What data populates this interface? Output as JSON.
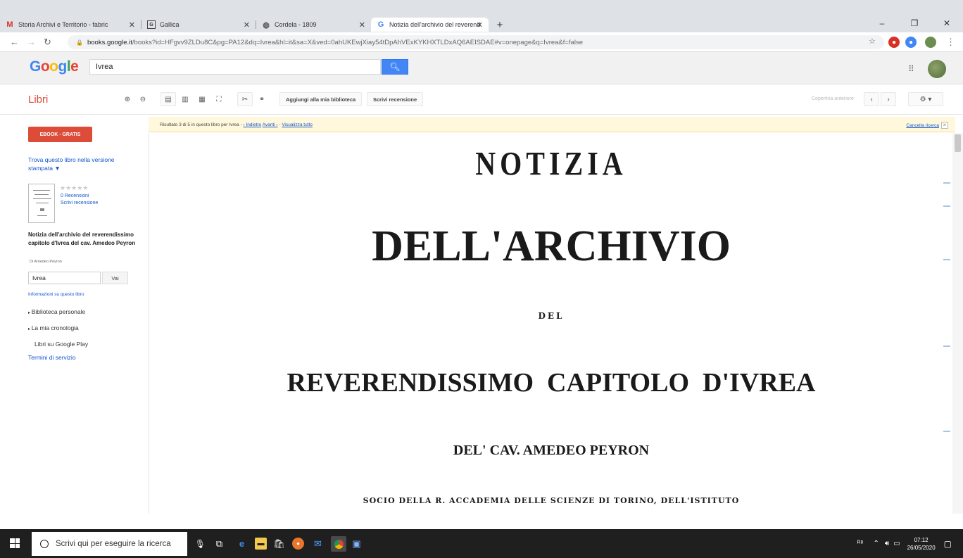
{
  "browser": {
    "tabs": [
      {
        "label": "Storia Archivi e Territorio - fabric",
        "favicon": "gmail-icon",
        "active": false
      },
      {
        "label": "Gallica",
        "favicon": "gallica-icon",
        "active": false
      },
      {
        "label": "Cordela - 1809",
        "favicon": "globe-icon",
        "active": false
      },
      {
        "label": "Notizia dell'archivio del reverend",
        "favicon": "google-icon",
        "active": true
      }
    ],
    "url_host": "books.google.it",
    "url_rest": "/books?id=HFgvv9ZLDu8C&pg=PA12&dq=Ivrea&hl=it&sa=X&ved=0ahUKEwjXiay54tDpAhVExKYKHXTLDxAQ6AEISDAE#v=onepage&q=Ivrea&f=false"
  },
  "google": {
    "logo": "Google",
    "search_value": "Ivrea"
  },
  "toolbar": {
    "section": "Libri",
    "add_library": "Aggiungi alla mia biblioteca",
    "write_review": "Scrivi recensione",
    "prev_cover": "Copertina anteriore"
  },
  "sidebar": {
    "ebook_button": "EBOOK - GRATIS",
    "find_print": "Trova questo libro nella versione stampata ▼",
    "stars": "★★★★★",
    "reviews": "0 Recensioni",
    "write_review": "Scrivi recensione",
    "book_title": "Notizia dell'archivio del reverendissimo capitolo d'Ivrea del cav. Amedeo Peyron",
    "author": "Di Amedeo Peyron",
    "search_value": "Ivrea",
    "search_button": "Vai",
    "info_link": "Informazioni su questo libro",
    "personal_library": "Biblioteca personale",
    "history": "La mia cronologia",
    "play_books": "Libri su Google Play",
    "terms": "Termini di servizio"
  },
  "results": {
    "summary": "Risultato 3 di 5 in questo libro per Ivrea",
    "back": "‹ Indietro",
    "next": "Avanti ›",
    "show_all": "Visualizza tutto",
    "clear": "Cancella ricerca"
  },
  "page": {
    "line1": "NOTIZIA",
    "line2": "DELL'ARCHIVIO",
    "line3": "DEL",
    "line4": "REVERENDISSIMO  CAPITOLO  D'IVREA",
    "line5": "DEL' CAV. AMEDEO PEYRON",
    "line6": "SOCIO DELLA R. ACCADEMIA DELLE SCIENZE DI TORINO, DELL'ISTITUTO"
  },
  "taskbar": {
    "search_placeholder": "Scrivi qui per eseguire la ricerca",
    "time": "07:12",
    "date": "26/05/2020"
  }
}
